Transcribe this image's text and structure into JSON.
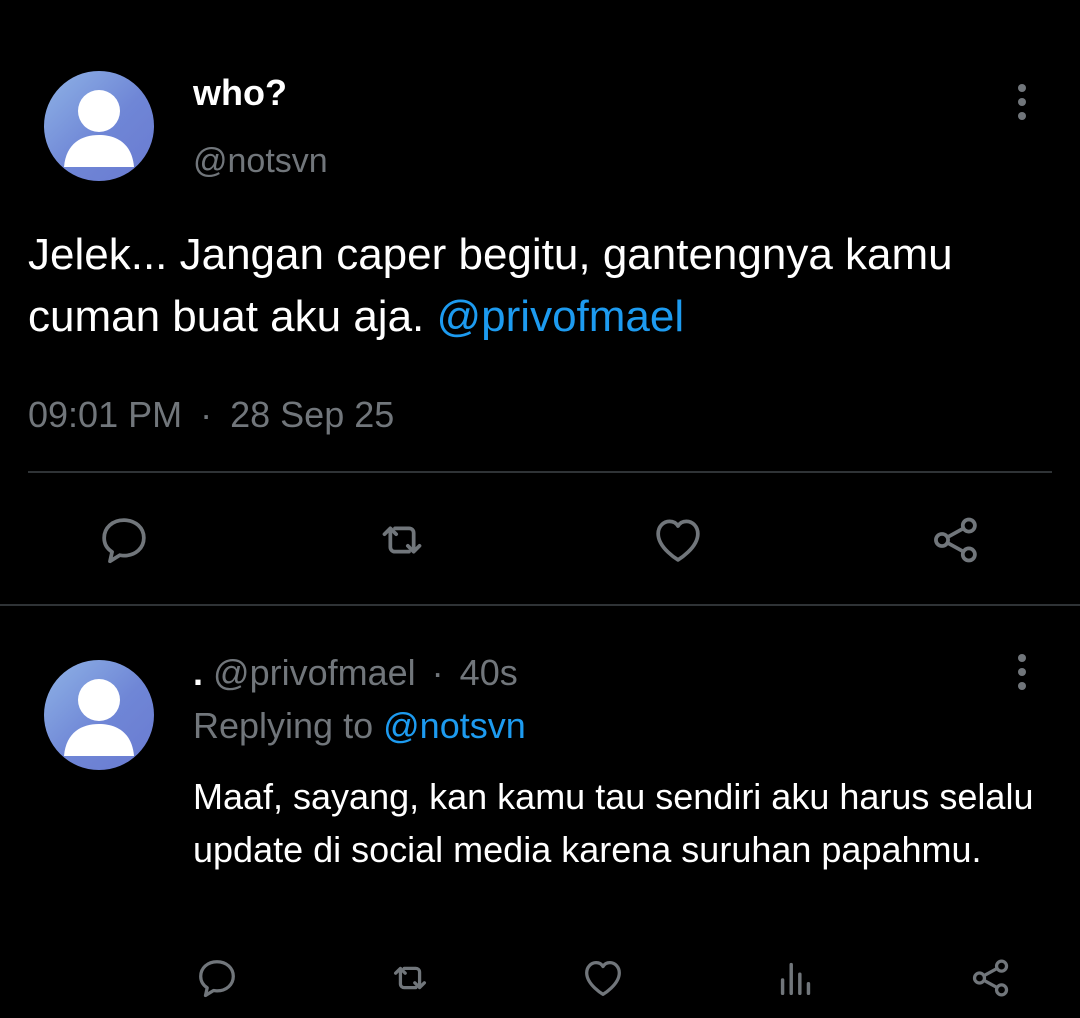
{
  "tweet": {
    "display_name": "who?",
    "handle": "@notsvn",
    "text_main": "Jelek... Jangan caper begitu, gantengnya kamu cuman buat aku aja.",
    "text_mention": "@privofmael",
    "time": "09:01 PM",
    "separator": "·",
    "date": "28 Sep 25"
  },
  "reply": {
    "display_name": ".",
    "handle": "@privofmael",
    "separator": "·",
    "age": "40s",
    "replying_prefix": "Replying to",
    "replying_handle": "@notsvn",
    "text": "Maaf, sayang, kan kamu tau sendiri aku harus selalu update di social media karena suruhan papahmu."
  },
  "icons": {
    "more": "more-vertical-icon",
    "reply": "reply-icon",
    "retweet": "retweet-icon",
    "like": "like-icon",
    "share": "share-icon",
    "views": "views-icon",
    "avatar": "default-avatar-icon"
  },
  "colors": {
    "background": "#000000",
    "text": "#ffffff",
    "muted": "#71767b",
    "link": "#1d9bf0",
    "divider": "#2f3336"
  }
}
